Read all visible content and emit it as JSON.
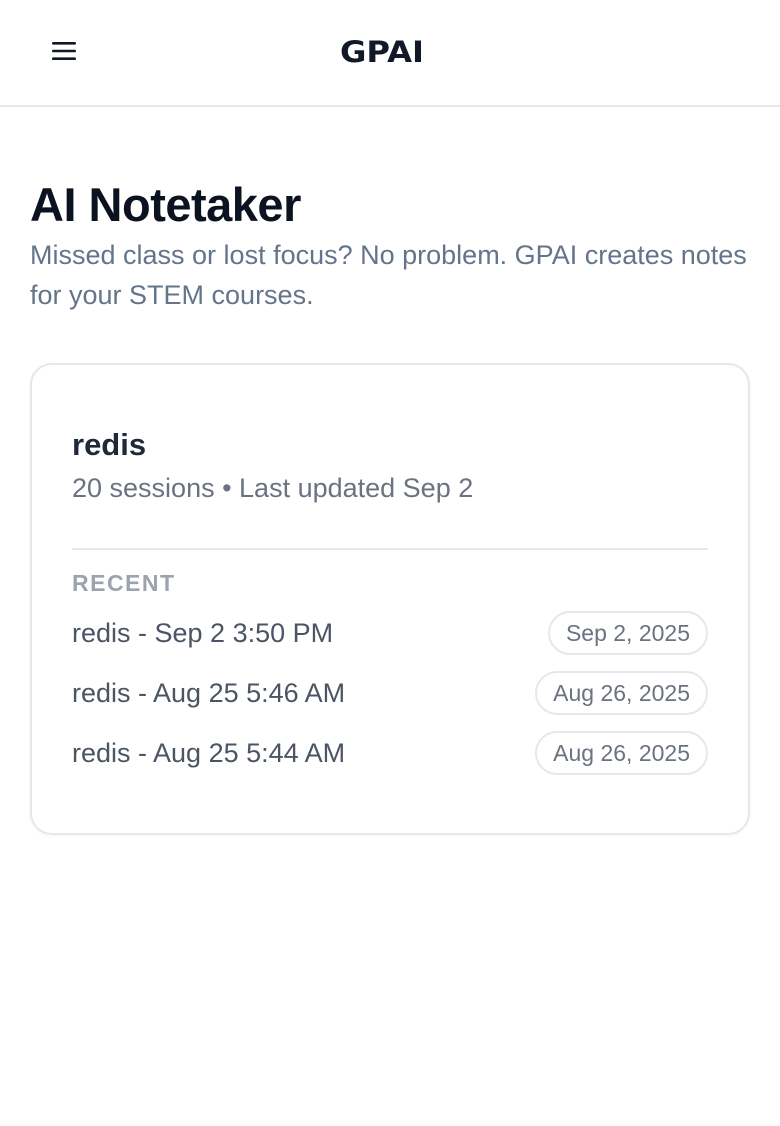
{
  "header": {
    "logo_text": "GPAI",
    "menu_icon": "hamburger-menu-icon"
  },
  "page": {
    "title": "AI Notetaker",
    "subtitle": "Missed class or lost focus? No problem. GPAI creates notes for your STEM courses."
  },
  "course": {
    "name": "redis",
    "meta": "20 sessions • Last updated Sep 2",
    "recent_label": "RECENT",
    "sessions": [
      {
        "title": "redis - Sep 2 3:50 PM",
        "date": "Sep 2, 2025"
      },
      {
        "title": "redis - Aug 25 5:46 AM",
        "date": "Aug 26, 2025"
      },
      {
        "title": "redis - Aug 25 5:44 AM",
        "date": "Aug 26, 2025"
      }
    ]
  },
  "colors": {
    "title": "#0b1220",
    "muted": "#64748b",
    "border": "#e5e7eb"
  }
}
